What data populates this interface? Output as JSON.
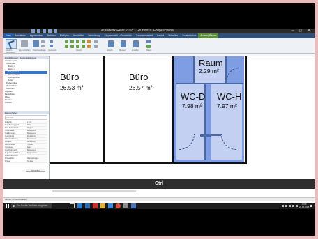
{
  "window": {
    "title": "Autodesk Revit 2018 - Grundriss: Erdgeschoss"
  },
  "ribbon": {
    "tabs": [
      "Datei",
      "Architektur",
      "Ingenieurbau",
      "Stahlbau",
      "Einfügen",
      "Beschriften",
      "Berechnung",
      "Körpermodell & Grundstück",
      "Zusammenarbeit",
      "Ansicht",
      "Verwalten",
      "Zusatzmodule",
      "Ändern | Räume"
    ],
    "active_tab": "Ändern | Räume",
    "modify_label": "Ändern",
    "group_labels": [
      "Auswählen",
      "Eigenschaften",
      "Zwischenablage",
      "Geometrie",
      "Ändern",
      "Ansicht",
      "Messen",
      "Erstellen",
      "Raum"
    ]
  },
  "project_browser": {
    "title": "Projektbrowser - Bestandsaufnahme",
    "items": [
      "Ansichten (alle)",
      "Grundrisse",
      "Ebene 0",
      "Ebene 1",
      "Erdgeschoss",
      "Obergeschoss",
      "Dachgeschoss",
      "Keller",
      "Deckenpläne",
      "3D-Ansichten",
      "Ansichten",
      "Legenden",
      "Bauteillisten",
      "Pläne",
      "Familien",
      "Gruppen"
    ],
    "selected_item": "Erdgeschoss"
  },
  "properties": {
    "title": "Eigenschaften",
    "type": "Grundriss",
    "rows": [
      {
        "k": "Maßstab",
        "v": "1:100"
      },
      {
        "k": "Detaillierungsgrad",
        "v": "Mittel"
      },
      {
        "k": "Teile-Sichtbarkeit",
        "v": "Original"
      },
      {
        "k": "Sichtbarkeit",
        "v": "Bearbeiten"
      },
      {
        "k": "Grafikanzeige",
        "v": "Bearbeiten"
      },
      {
        "k": "Ausrichtung",
        "v": "Projektnord"
      },
      {
        "k": "Wandverbindung",
        "v": "Bereinigen"
      },
      {
        "k": "Disziplin",
        "v": "Architektur"
      },
      {
        "k": "Farbschema",
        "v": "<Keine>"
      },
      {
        "k": "Unterlage",
        "v": "Keine"
      },
      {
        "k": "Ansichtsbereich",
        "v": "Bearbeiten"
      },
      {
        "k": "Zugeordnete Ebene",
        "v": "Erdgeschoss"
      },
      {
        "k": "Zuschnittbereich",
        "v": ""
      },
      {
        "k": "Phasenfilter",
        "v": "Alles anzeigen"
      },
      {
        "k": "Phase",
        "v": "Neubau"
      }
    ],
    "apply_label": "Anwenden"
  },
  "rooms": [
    {
      "name": "Büro",
      "area": "26.53 m²"
    },
    {
      "name": "Büro",
      "area": "26.57 m²"
    },
    {
      "name": "Raum",
      "area": "2.29 m²"
    },
    {
      "name": "WC-D",
      "area": "7.98 m²"
    },
    {
      "name": "WC-H",
      "area": "7.97 m²"
    }
  ],
  "view_control": {
    "scale": "1 : 100"
  },
  "keystroke_overlay": {
    "label": "Ctrl"
  },
  "status_bar": {
    "text": "Klicken, um auszuwählen"
  },
  "taskbar": {
    "search_placeholder": "Zur Suche Text hier eingeben",
    "time": "14:56",
    "date": "23.08.2018"
  },
  "colors": {
    "room_selection_blue": "#7f9de3",
    "ribbon_tab_bar": "#2f4f78",
    "active_tab": "#5a8c3c"
  }
}
